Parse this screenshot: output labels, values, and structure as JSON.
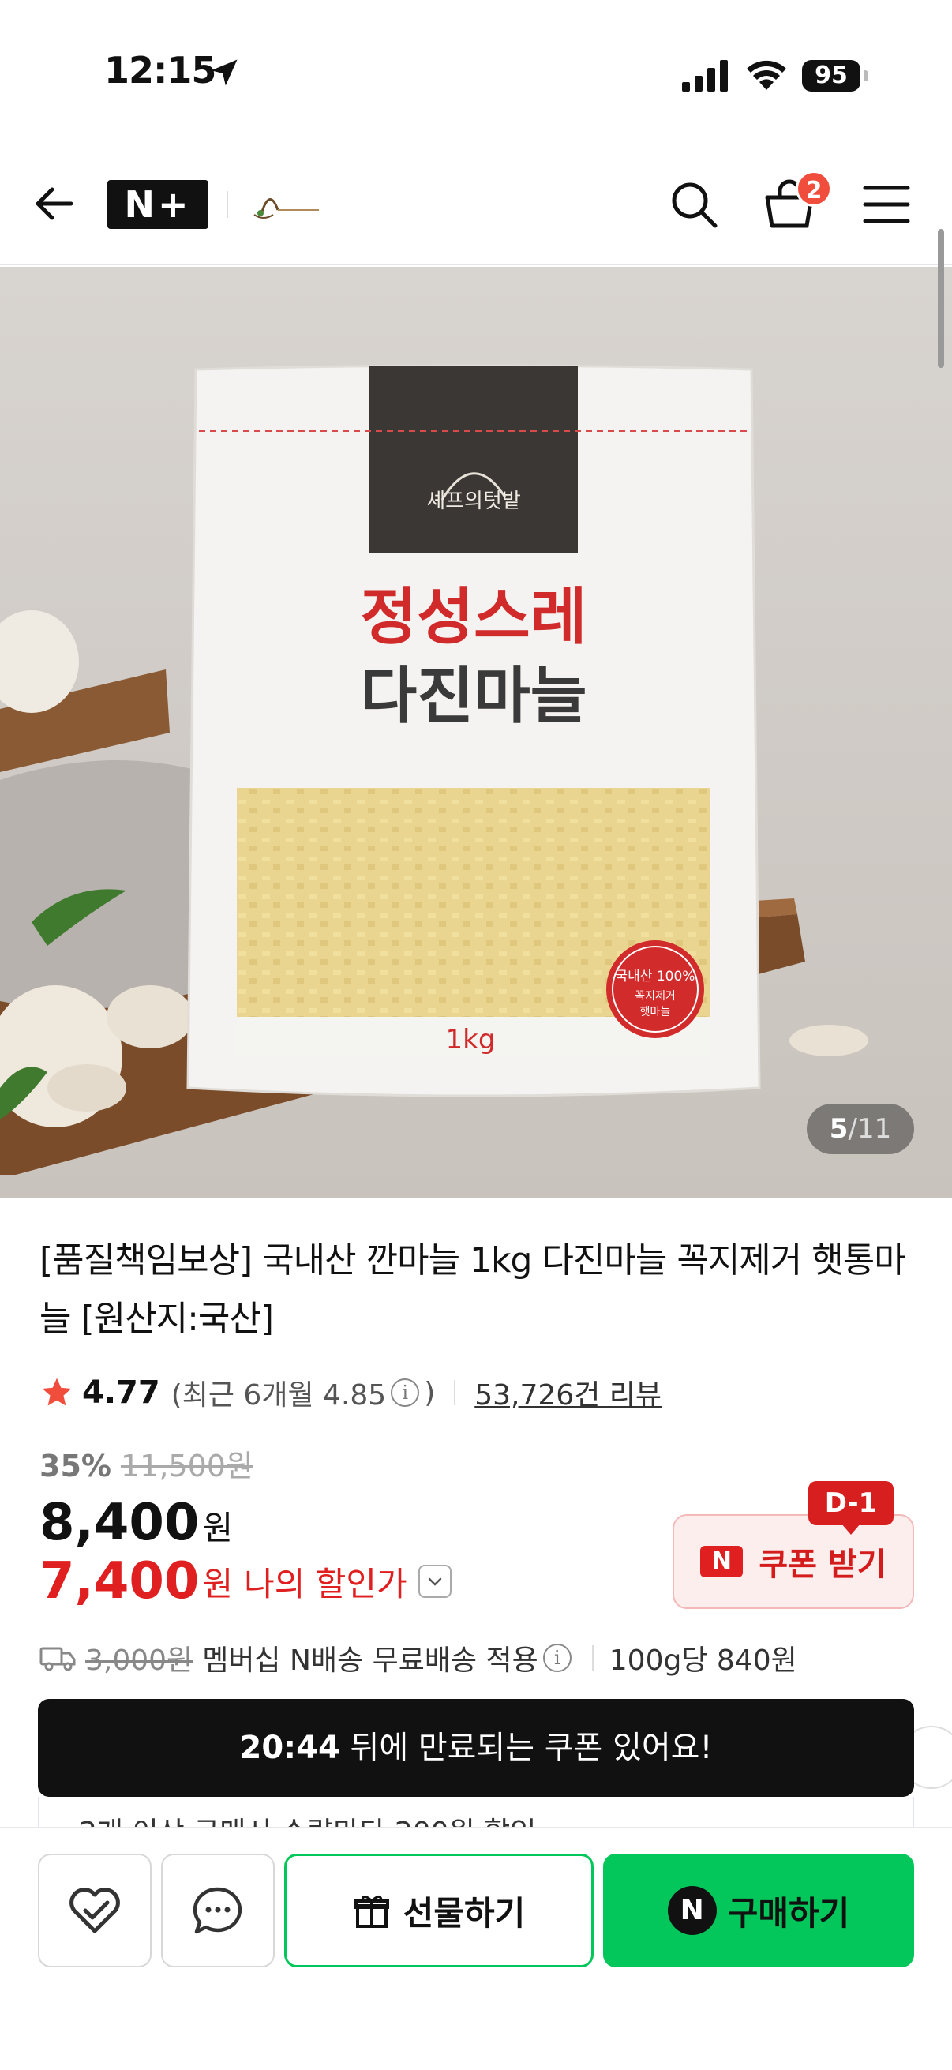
{
  "status_bar": {
    "time": "12:15",
    "battery": "95"
  },
  "header": {
    "logo_text": "N+",
    "brand_logo_text": "셰프의텃밭",
    "cart_count": "2"
  },
  "gallery": {
    "current": "5",
    "separator": "/",
    "total": "11",
    "package": {
      "brand_text": "셰프의텃밭",
      "title_line1": "정성스레",
      "title_line2": "다진마늘",
      "weight": "1kg",
      "seal_line1": "국내산 100%",
      "seal_line2": "꼭지제거",
      "seal_line3": "햇마늘"
    }
  },
  "product": {
    "title": "[품질책임보상] 국내산 깐마늘 1kg 다진마늘 꼭지제거 햇통마늘 [원산지:국산]",
    "rating": "4.77",
    "recent_rating_prefix": "(최근 6개월 4.85",
    "recent_rating_suffix": ")",
    "info_glyph": "i",
    "review_count": "53,726건 리뷰",
    "discount_rate": "35%",
    "original_price": "11,500원",
    "sale_price": "8,400",
    "price_unit": "원",
    "my_price": "7,400",
    "my_price_label": "나의 할인가"
  },
  "coupon": {
    "dday": "D-1",
    "n_mark": "N",
    "label": "쿠폰 받기"
  },
  "shipping": {
    "original_fee": "3,000원",
    "text": "멤버십 N배송 무료배송 적용",
    "unit_price": "100g당 840원"
  },
  "expire_banner": {
    "time": "20:44",
    "text": " 뒤에 만료되는 쿠폰 있어요!"
  },
  "promo": {
    "text": "2개 이상 구매시 수량마다 200원 할인"
  },
  "bottom_bar": {
    "gift_label": "선물하기",
    "buy_n": "N",
    "buy_label": "구매하기"
  },
  "colors": {
    "naver_green": "#03c75a",
    "price_red": "#e02020",
    "badge_red": "#f04d3c"
  }
}
